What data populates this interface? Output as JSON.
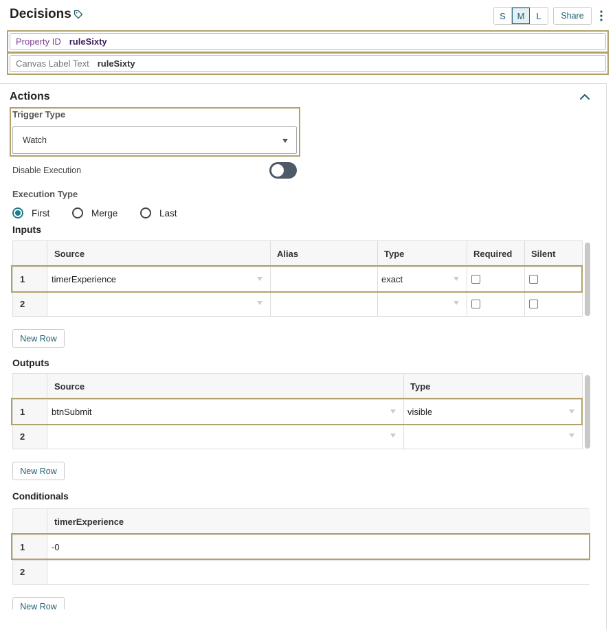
{
  "header": {
    "title": "Decisions",
    "size_options": [
      {
        "label": "S",
        "active": false
      },
      {
        "label": "M",
        "active": true
      },
      {
        "label": "L",
        "active": false
      }
    ],
    "share_label": "Share"
  },
  "properties": {
    "property_id_label": "Property ID",
    "property_id_value": "ruleSixty",
    "canvas_label_label": "Canvas Label Text",
    "canvas_label_value": "ruleSixty"
  },
  "actions": {
    "title": "Actions",
    "trigger_type_label": "Trigger Type",
    "trigger_type_value": "Watch",
    "disable_execution_label": "Disable Execution",
    "disable_execution_on": false,
    "execution_type_label": "Execution Type",
    "execution_options": [
      {
        "label": "First",
        "checked": true
      },
      {
        "label": "Merge",
        "checked": false
      },
      {
        "label": "Last",
        "checked": false
      }
    ],
    "selected_execution": "First"
  },
  "inputs": {
    "title": "Inputs",
    "columns": [
      "Source",
      "Alias",
      "Type",
      "Required",
      "Silent"
    ],
    "rows": [
      {
        "num": "1",
        "source": "timerExperience",
        "alias": "",
        "type": "exact",
        "required": false,
        "silent": false
      },
      {
        "num": "2",
        "source": "",
        "alias": "",
        "type": "",
        "required": false,
        "silent": false
      }
    ],
    "new_row_label": "New Row"
  },
  "outputs": {
    "title": "Outputs",
    "columns": [
      "Source",
      "Type"
    ],
    "rows": [
      {
        "num": "1",
        "source": "btnSubmit",
        "type": "visible"
      },
      {
        "num": "2",
        "source": "",
        "type": ""
      }
    ],
    "new_row_label": "New Row"
  },
  "conditionals": {
    "title": "Conditionals",
    "columns": [
      "timerExperience"
    ],
    "rows": [
      {
        "num": "1",
        "value": "-0"
      },
      {
        "num": "2",
        "value": ""
      }
    ],
    "new_row_label": "New Row"
  },
  "colors": {
    "accent": "#1f5f73",
    "highlight_outline": "#b0a26a",
    "property_label": "#7a3e97",
    "toggle_off": "#4e5b66"
  },
  "icons": [
    "tag-icon",
    "kebab-menu-icon",
    "chevron-up-icon",
    "dropdown-caret-icon"
  ]
}
